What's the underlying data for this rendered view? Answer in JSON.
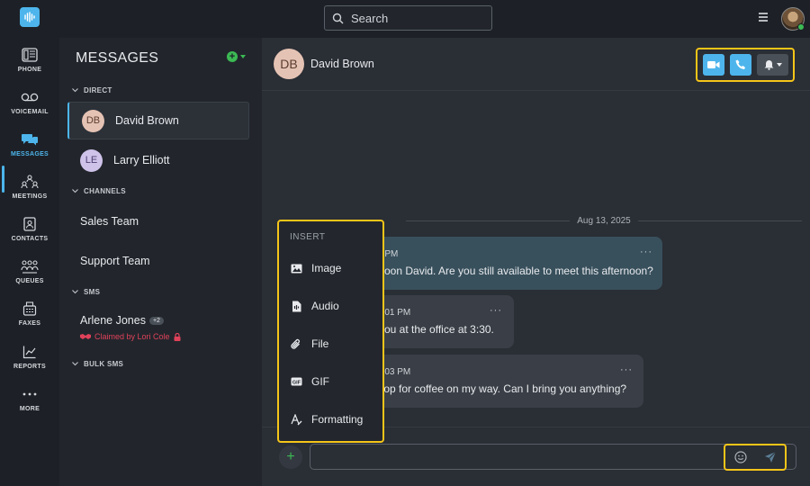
{
  "search": {
    "placeholder": "Search"
  },
  "nav": [
    {
      "label": "PHONE",
      "icon": "phone-icon"
    },
    {
      "label": "VOICEMAIL",
      "icon": "voicemail-icon"
    },
    {
      "label": "MESSAGES",
      "icon": "messages-icon",
      "active": true
    },
    {
      "label": "MEETINGS",
      "icon": "meetings-icon"
    },
    {
      "label": "CONTACTS",
      "icon": "contacts-icon"
    },
    {
      "label": "QUEUES",
      "icon": "queues-icon"
    },
    {
      "label": "FAXES",
      "icon": "faxes-icon"
    },
    {
      "label": "REPORTS",
      "icon": "reports-icon"
    },
    {
      "label": "MORE",
      "icon": "more-icon"
    }
  ],
  "conversations": {
    "title": "MESSAGES",
    "sections": {
      "direct": "DIRECT",
      "channels": "CHANNELS",
      "sms": "SMS",
      "bulk_sms": "BULK SMS"
    },
    "direct": [
      {
        "initials": "DB",
        "name": "David Brown",
        "selected": true
      },
      {
        "initials": "LE",
        "name": "Larry Elliott"
      }
    ],
    "channels": [
      "Sales Team",
      "Support Team"
    ],
    "sms": {
      "name": "Arlene Jones",
      "badge": "+2",
      "claimed": "Claimed by Lori Cole"
    }
  },
  "chat": {
    "contact_initials": "DB",
    "contact_name": "David Brown",
    "date": "Aug 13, 2025",
    "messages": [
      {
        "time": "0 PM",
        "text": "oon David. Are you still available to meet this afternoon?"
      },
      {
        "time": "2:01 PM",
        "text": "you at the office at 3:30."
      },
      {
        "time": "2:03 PM",
        "text": "stop for coffee on my way. Can I bring you anything?"
      }
    ],
    "more": "···"
  },
  "insert_menu": {
    "title": "INSERT",
    "items": [
      {
        "label": "Image",
        "icon": "image-icon"
      },
      {
        "label": "Audio",
        "icon": "audio-icon"
      },
      {
        "label": "File",
        "icon": "paperclip-icon"
      },
      {
        "label": "GIF",
        "icon": "gif-icon"
      },
      {
        "label": "Formatting",
        "icon": "formatting-icon"
      }
    ]
  },
  "colors": {
    "accent": "#4db5ec",
    "highlight": "#f5c518",
    "green": "#3cba54",
    "claimed": "#e0415a"
  }
}
